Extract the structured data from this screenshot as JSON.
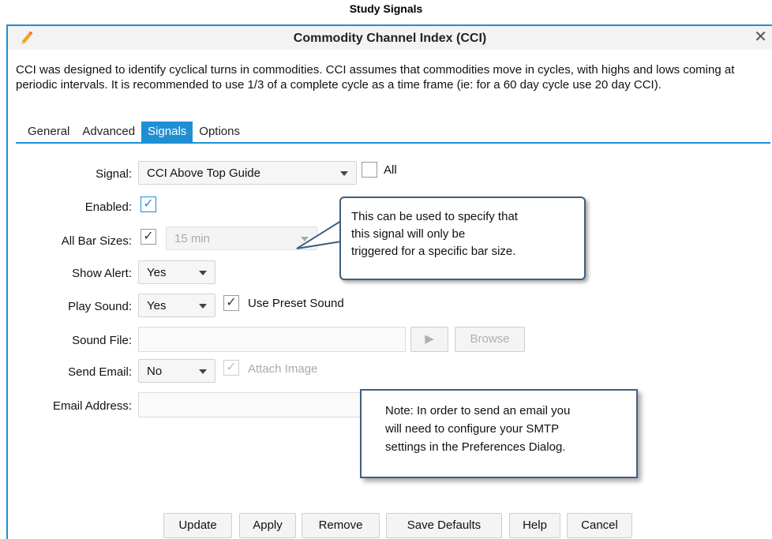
{
  "caption": "Study Signals",
  "dialog": {
    "title": "Commodity Channel Index (CCI)",
    "close_glyph": "✕",
    "description": "CCI was designed to identify cyclical turns in commodities.  CCI assumes that commodities move in cycles, with highs and lows coming at periodic intervals.  It is recommended to use 1/3 of a complete cycle as a time frame (ie: for a 60 day cycle use 20 day CCI).",
    "accent_color": "#1f8fd4"
  },
  "tabs": [
    {
      "label": "General",
      "active": false
    },
    {
      "label": "Advanced",
      "active": false
    },
    {
      "label": "Signals",
      "active": true
    },
    {
      "label": "Options",
      "active": false
    }
  ],
  "form": {
    "signal": {
      "label": "Signal:",
      "value": "CCI Above Top Guide",
      "all_label": "All",
      "all_checked": false
    },
    "enabled": {
      "label": "Enabled:",
      "checked": true
    },
    "all_bar_sizes": {
      "label": "All Bar Sizes:",
      "checked": true,
      "bar_size_value": "15 min"
    },
    "show_alert": {
      "label": "Show Alert:",
      "value": "Yes"
    },
    "play_sound": {
      "label": "Play Sound:",
      "value": "Yes",
      "use_preset_label": "Use Preset Sound",
      "use_preset_checked": true
    },
    "sound_file": {
      "label": "Sound File:",
      "value": "",
      "play_glyph": "▶",
      "browse_label": "Browse"
    },
    "send_email": {
      "label": "Send Email:",
      "value": "No",
      "attach_label": "Attach Image",
      "attach_checked": true
    },
    "email_address": {
      "label": "Email Address:",
      "value": ""
    }
  },
  "callouts": {
    "bar_size": {
      "lines": [
        "This can be used to specify that",
        "this signal will only be",
        "triggered for a specific bar size."
      ]
    },
    "email_note": {
      "lines": [
        "Note: In order to send an email you",
        "will need to configure your SMTP",
        "settings in the Preferences Dialog."
      ]
    }
  },
  "buttons": {
    "update": "Update",
    "apply": "Apply",
    "remove": "Remove",
    "save_defaults": "Save Defaults",
    "help": "Help",
    "cancel": "Cancel"
  }
}
